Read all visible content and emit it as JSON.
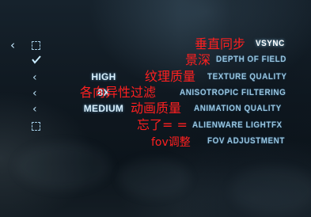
{
  "menu": {
    "rows": [
      {
        "control": "checkbox-empty",
        "value": "",
        "option": "VSYNC",
        "active": true,
        "annotation": "垂直同步"
      },
      {
        "control": "checkbox-checked",
        "value": "",
        "option": "DEPTH OF FIELD",
        "active": false,
        "annotation": "景深"
      },
      {
        "control": "selector",
        "value": "HIGH",
        "option": "TEXTURE QUALITY",
        "active": false,
        "annotation": "纹理质量"
      },
      {
        "control": "selector",
        "value": "8X",
        "option": "ANISOTROPIC FILTERING",
        "active": false,
        "annotation": "各向异性过滤"
      },
      {
        "control": "selector",
        "value": "MEDIUM",
        "option": "ANIMATION QUALITY",
        "active": false,
        "annotation": "动画质量"
      },
      {
        "control": "checkbox-empty",
        "value": "",
        "option": "ALIENWARE LIGHTFX",
        "active": false,
        "annotation": "忘了= ="
      },
      {
        "control": "none",
        "value": "",
        "option": "FOV ADJUSTMENT",
        "active": false,
        "annotation": "fov调整"
      }
    ]
  },
  "colors": {
    "annotation": "#ff2020",
    "option": "#98c4de",
    "active": "#ffffff",
    "value": "#d7eefb"
  }
}
